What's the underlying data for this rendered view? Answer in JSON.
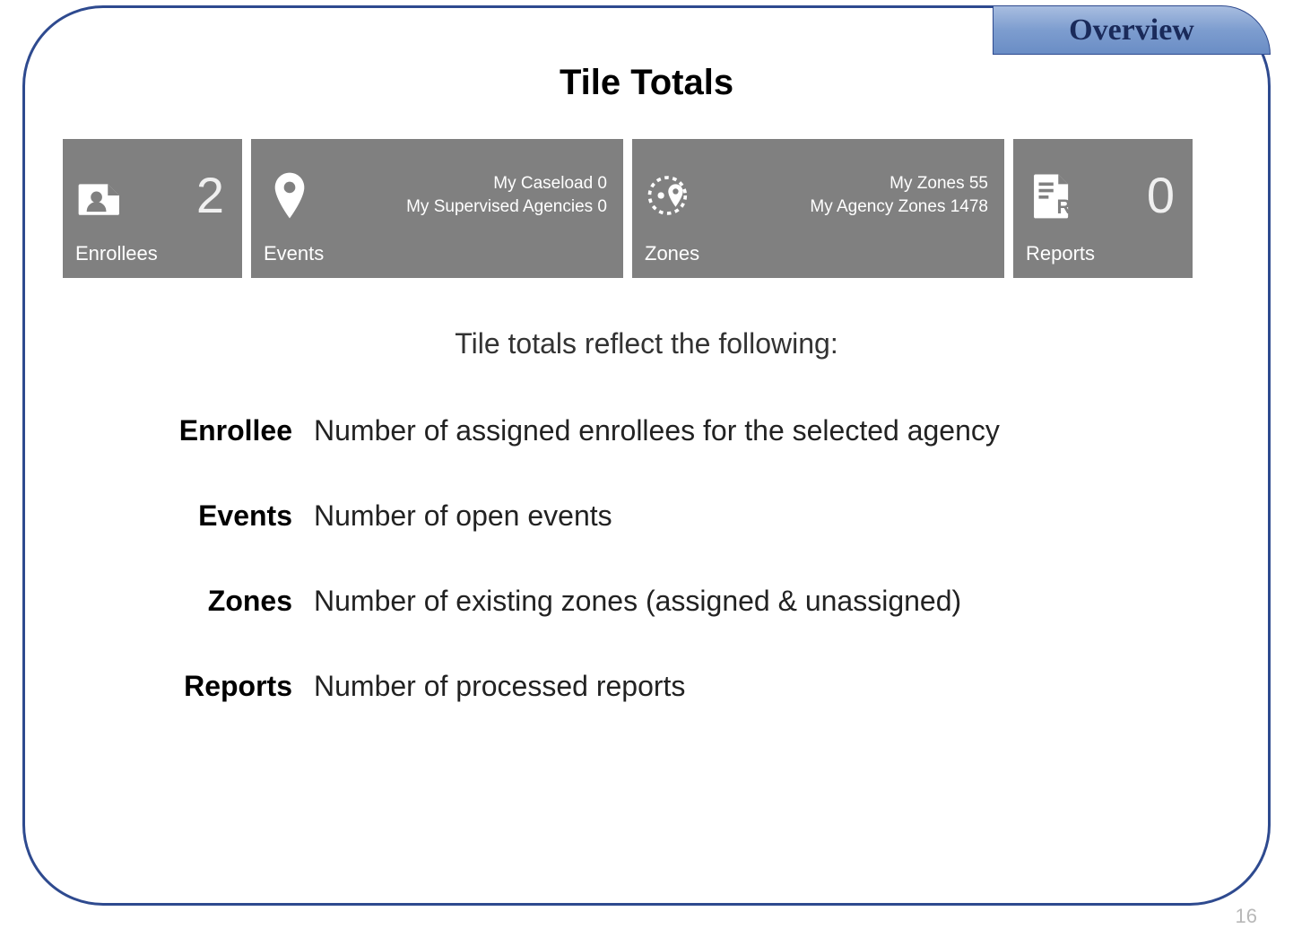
{
  "header": {
    "tab_label": "Overview"
  },
  "page": {
    "title": "Tile Totals",
    "number": "16",
    "intro": "Tile totals reflect the following:"
  },
  "tiles": {
    "enrollees": {
      "label": "Enrollees",
      "count": "2"
    },
    "events": {
      "label": "Events",
      "line1": "My Caseload 0",
      "line2": "My Supervised Agencies 0"
    },
    "zones": {
      "label": "Zones",
      "line1": "My Zones 55",
      "line2": "My Agency Zones 1478"
    },
    "reports": {
      "label": "Reports",
      "count": "0"
    }
  },
  "definitions": [
    {
      "term": "Enrollee",
      "desc": "Number of assigned enrollees for the selected agency"
    },
    {
      "term": "Events",
      "desc": "Number of open events"
    },
    {
      "term": "Zones",
      "desc": "Number of existing zones (assigned & unassigned)"
    },
    {
      "term": "Reports",
      "desc": "Number of processed reports"
    }
  ]
}
